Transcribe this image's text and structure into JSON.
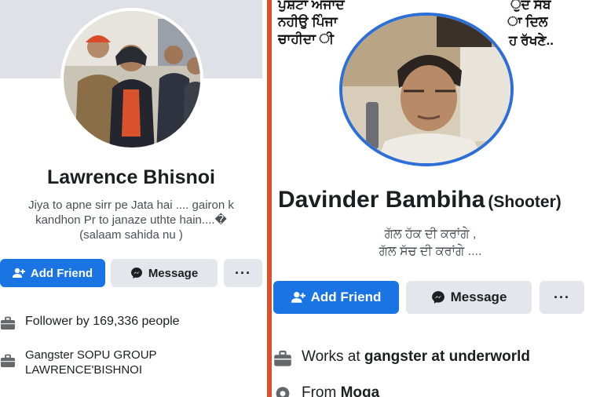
{
  "left": {
    "name": "Lawrence Bhisnoi",
    "bio_line1": "Jiya to apne sirr pe Jata hai .... gairon k",
    "bio_line2": "kandhon Pr to janaze uthte hain....�",
    "bio_line3": "(salaam sahida nu )",
    "buttons": {
      "add_friend": "Add Friend",
      "message": "Message",
      "more": "···"
    },
    "info": [
      {
        "icon": "briefcase-icon",
        "text": "Follower by 169,336 people"
      },
      {
        "icon": "briefcase-icon",
        "text_line1": "Gangster SOPU GROUP",
        "text_line2": "LAWRENCE'BISHNOI"
      }
    ]
  },
  "right": {
    "cover_text": {
      "line1": "ਪੁਸ਼ਟਾ ਅਜਾਦ",
      "line2": "ਨਹੀਉ ਪਿੰਜਾ",
      "line3": "ਚਾਹੀਦਾ ੀ",
      "line4": "ੁੰਦ ਸੱਬ",
      "line5": "ਾ ਦਿਲ",
      "line6": "ਹ ਰੱਖਣੇ.."
    },
    "name": "Davinder Bambiha",
    "name_suffix": "(Shooter)",
    "bio_line1": "ਗੱਲ ਹੱਕ ਦੀ ਕਰਾਂਗੇ ,",
    "bio_line2": "ਗੱਲ ਸੱਚ ਦੀ ਕਰਾਂਗੇ ....",
    "buttons": {
      "add_friend": "Add Friend",
      "message": "Message",
      "more": "···"
    },
    "info": [
      {
        "icon": "briefcase-icon",
        "prefix": "Works at ",
        "bold": "gangster at underworld"
      },
      {
        "icon": "location-pin-icon",
        "prefix": "From ",
        "bold": "Moga"
      }
    ]
  },
  "colors": {
    "primary_button": "#1b74e4",
    "secondary_button": "#e4e6eb",
    "divider": "#d9502f",
    "avatar_ring": "#2d6fd6"
  }
}
